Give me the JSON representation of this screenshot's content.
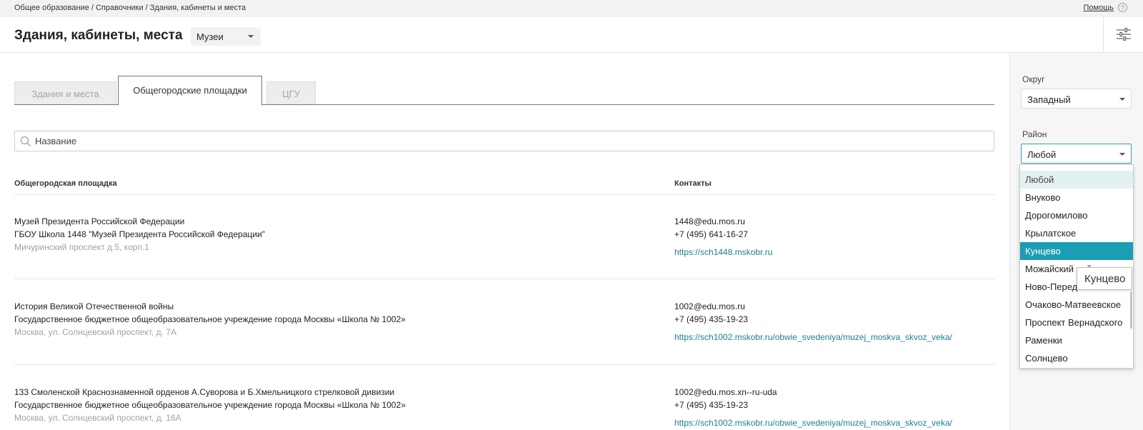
{
  "breadcrumb": "Общее образование / Справочники / Здания, кабинеты и места",
  "help": {
    "label": "Помощь",
    "icon": "?"
  },
  "header": {
    "title": "Здания, кабинеты, места",
    "type_select": "Музеи"
  },
  "tabs": [
    "Здания и места",
    "Общегородские площадки",
    "ЦГУ"
  ],
  "search": {
    "placeholder": "Название"
  },
  "table": {
    "headers": [
      "Общегородская площадка",
      "Контакты"
    ],
    "rows": [
      {
        "title": "Музей Президента Российской Федерации",
        "org": "ГБОУ Школа 1448 \"Музей Президента Российской Федерации\"",
        "address": "Мичуринский проспект д.5, корп.1",
        "email": "1448@edu.mos.ru",
        "phone": "+7 (495) 641-16-27",
        "url": "https://sch1448.mskobr.ru"
      },
      {
        "title": "История Великой Отечественной войны",
        "org": "Государственное бюджетное общеобразовательное учреждение города Москвы «Школа № 1002»",
        "address": "Москва, ул. Солнцевский проспект, д. 7А",
        "email": "1002@edu.mos.ru",
        "phone": "+7 (495) 435-19-23",
        "url": "https://sch1002.mskobr.ru/obwie_svedeniya/muzej_moskva_skvoz_veka/"
      },
      {
        "title": "133 Смоленской Краснознаменной орденов А.Суворова и Б.Хмельницкого стрелковой дивизии",
        "org": "Государственное бюджетное общеобразовательное учреждение города Москвы «Школа № 1002»",
        "address": "Москва, ул. Солнцевский проспект, д. 16А",
        "email": "1002@edu.mos.xn--ru-uda",
        "phone": "+7 (495) 435-19-23",
        "url": "https://sch1002.mskobr.ru/obwie_svedeniya/muzej_moskva_skvoz_veka/"
      }
    ]
  },
  "sidebar": {
    "okrug_label": "Округ",
    "okrug_value": "Западный",
    "rayon_label": "Район",
    "rayon_value": "Любой",
    "rayon_options": [
      "Любой",
      "Внуково",
      "Дорогомилово",
      "Крылатское",
      "Кунцево",
      "Можайский район",
      "Ново-Переделкино",
      "Очаково-Матвеевское",
      "Проспект Вернадского",
      "Раменки",
      "Солнцево"
    ],
    "highlighted_option": "Кунцево",
    "tooltip": "Кунцево"
  },
  "colors": {
    "accent": "#1b9eb3",
    "link": "#1c7f95"
  }
}
